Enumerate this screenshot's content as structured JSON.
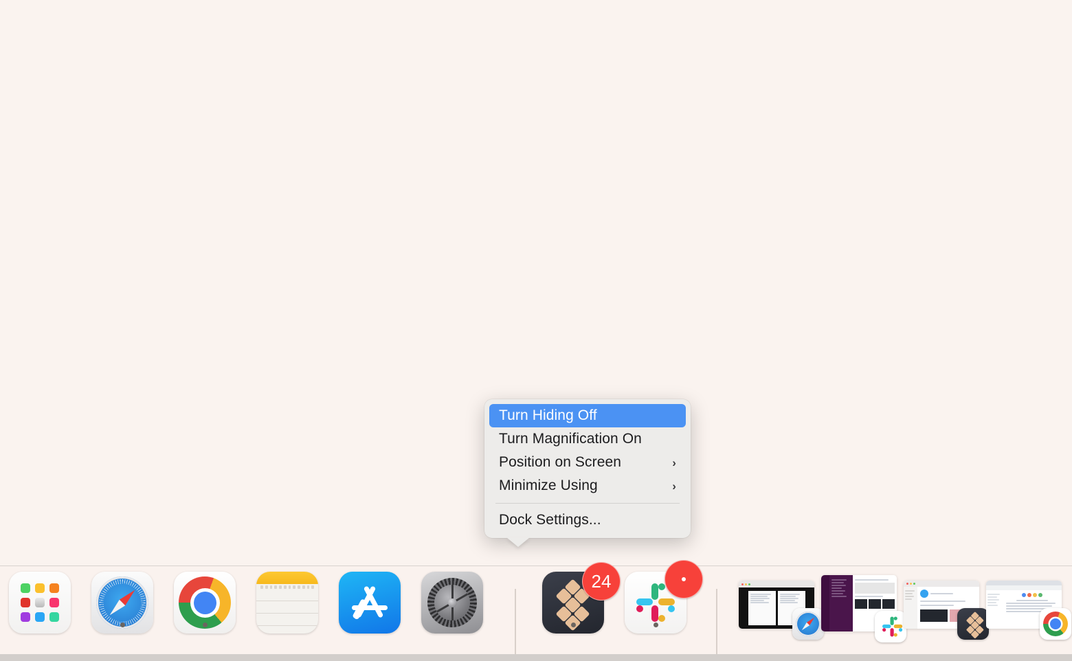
{
  "desktop": {
    "background_color": "#faf3ef"
  },
  "context_menu": {
    "name": "dock-context-menu",
    "accent_color": "#4b92f3",
    "background_color": "#edecea",
    "items": [
      {
        "label": "Turn Hiding Off",
        "selected": true,
        "submenu": false
      },
      {
        "label": "Turn Magnification On",
        "selected": false,
        "submenu": false
      },
      {
        "label": "Position on Screen",
        "selected": false,
        "submenu": true
      },
      {
        "label": "Minimize Using",
        "selected": false,
        "submenu": true
      }
    ],
    "footer_items": [
      {
        "label": "Dock Settings...",
        "selected": false,
        "submenu": false
      }
    ],
    "chevron_glyph": "›"
  },
  "dock": {
    "background_color": "#faf2ee",
    "apps": [
      {
        "name": "Launchpad",
        "icon": "launchpad-icon",
        "running": false,
        "badge": null
      },
      {
        "name": "Safari",
        "icon": "safari-icon",
        "running": true,
        "badge": null
      },
      {
        "name": "Google Chrome",
        "icon": "chrome-icon",
        "running": true,
        "badge": null
      },
      {
        "name": "Notes",
        "icon": "notes-icon",
        "running": false,
        "badge": null
      },
      {
        "name": "App Store",
        "icon": "app-store-icon",
        "running": false,
        "badge": null
      },
      {
        "name": "System Settings",
        "icon": "system-settings-icon",
        "running": false,
        "badge": null
      },
      {
        "name": "Setapp",
        "icon": "setapp-icon",
        "running": true,
        "badge": "24"
      },
      {
        "name": "Slack",
        "icon": "slack-icon",
        "running": true,
        "badge": "•"
      }
    ],
    "badge_color": "#f7413a",
    "minimized_windows": [
      {
        "name": "Safari minimized window",
        "app_badge": "safari-icon"
      },
      {
        "name": "Slack minimized window",
        "app_badge": "slack-icon"
      },
      {
        "name": "Setapp minimized window",
        "app_badge": "setapp-icon"
      },
      {
        "name": "Chrome minimized window",
        "app_badge": "chrome-icon"
      }
    ]
  }
}
